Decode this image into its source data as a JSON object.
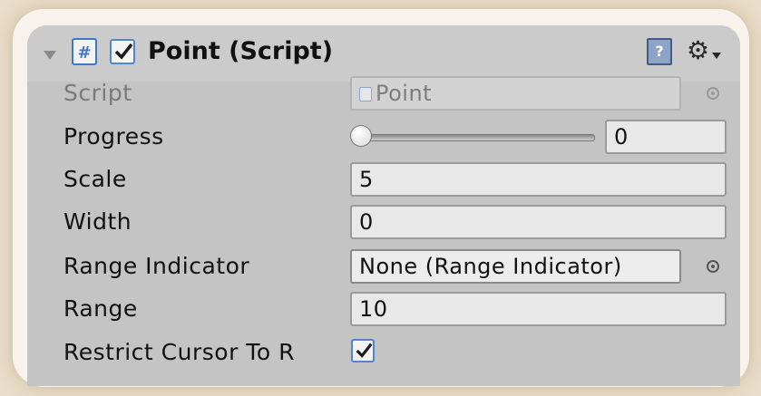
{
  "component": {
    "title": "Point (Script)",
    "enabled": true,
    "icons": {
      "fold": "triangle-down-icon",
      "script": "csharp-script-icon",
      "help": "help-book-icon",
      "settings": "gear-dropdown-icon"
    }
  },
  "fields": {
    "script": {
      "label": "Script",
      "value": "Point"
    },
    "progress": {
      "label": "Progress",
      "value": "0",
      "slider_fraction": 0
    },
    "scale": {
      "label": "Scale",
      "value": "5"
    },
    "width": {
      "label": "Width",
      "value": "0"
    },
    "range_indicator": {
      "label": "Range Indicator",
      "value": "None (Range Indicator)"
    },
    "range": {
      "label": "Range",
      "value": "10"
    },
    "restrict_cursor": {
      "label": "Restrict Cursor To R",
      "checked": true
    }
  },
  "colors": {
    "panel_bg": "#c4c4c4",
    "checkbox_accent": "#4e86d6"
  }
}
